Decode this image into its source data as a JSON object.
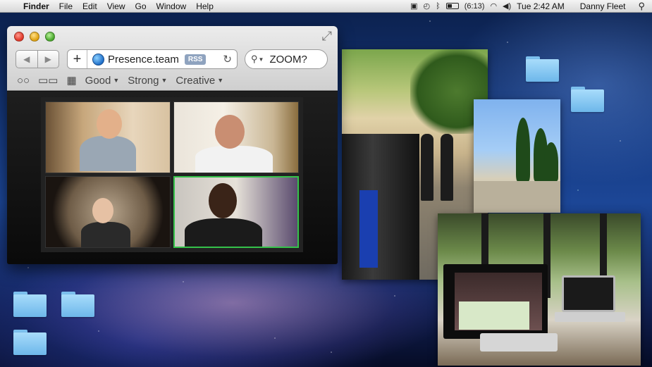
{
  "menubar": {
    "apple_icon": "apple-icon",
    "app_name": "Finder",
    "menus": [
      "File",
      "Edit",
      "View",
      "Go",
      "Window",
      "Help"
    ],
    "battery_text": "(6:13)",
    "clock": "Tue 2:42 AM",
    "user": "Danny Fleet",
    "status_icons": [
      "timemachine-icon",
      "clock-icon",
      "bluetooth-icon",
      "battery-icon",
      "wifi-icon",
      "volume-icon",
      "spotlight-icon"
    ]
  },
  "browser": {
    "address": {
      "url": "Presence.team",
      "rss_label": "RSS"
    },
    "search": {
      "value": "ZOOM?"
    },
    "bookmarks": [
      {
        "label": "Good"
      },
      {
        "label": "Strong"
      },
      {
        "label": "Creative"
      }
    ],
    "video_tiles": 4
  },
  "desktop": {
    "folders": 5,
    "photos": [
      "film-set-photo",
      "trees-photo",
      "office-photo"
    ]
  },
  "colors": {
    "menubar": "#e4e4e4",
    "folder": "#8ccdf3",
    "active_speaker": "#35c24a",
    "rss_badge": "#8fa3bf"
  }
}
